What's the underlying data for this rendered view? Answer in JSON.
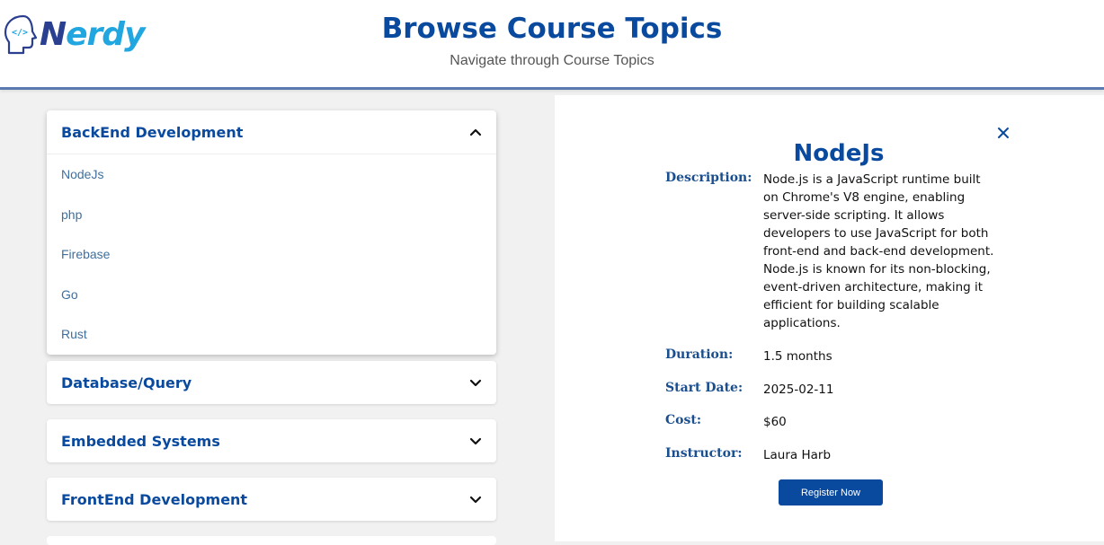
{
  "header": {
    "logo_text": "Nerdy",
    "title": "Browse Course Topics",
    "subtitle": "Navigate through Course Topics"
  },
  "accordion": {
    "sections": [
      {
        "title": "BackEnd Development",
        "expanded": true,
        "items": [
          "NodeJs",
          "php",
          "Firebase",
          "Go",
          "Rust"
        ]
      },
      {
        "title": "Database/Query",
        "expanded": false
      },
      {
        "title": "Embedded Systems",
        "expanded": false
      },
      {
        "title": "FrontEnd Development",
        "expanded": false
      }
    ]
  },
  "detail": {
    "title": "NodeJs",
    "description_label": "Description:",
    "description": "Node.js is a JavaScript runtime built on Chrome's V8 engine, enabling server-side scripting. It allows developers to use JavaScript for both front-end and back-end development. Node.js is known for its non-blocking, event-driven architecture, making it efficient for building scalable applications.",
    "duration_label": "Duration:",
    "duration": "1.5 months",
    "start_date_label": "Start Date:",
    "start_date": "2025-02-11",
    "cost_label": "Cost:",
    "cost": "$60",
    "instructor_label": "Instructor:",
    "instructor": "Laura Harb",
    "register_label": "Register Now",
    "close_icon": "close-icon"
  },
  "colors": {
    "accent": "#0a4a9e",
    "link": "#3f6f9f",
    "logo_dark": "#2a3f8f",
    "logo_light": "#22a6df"
  }
}
